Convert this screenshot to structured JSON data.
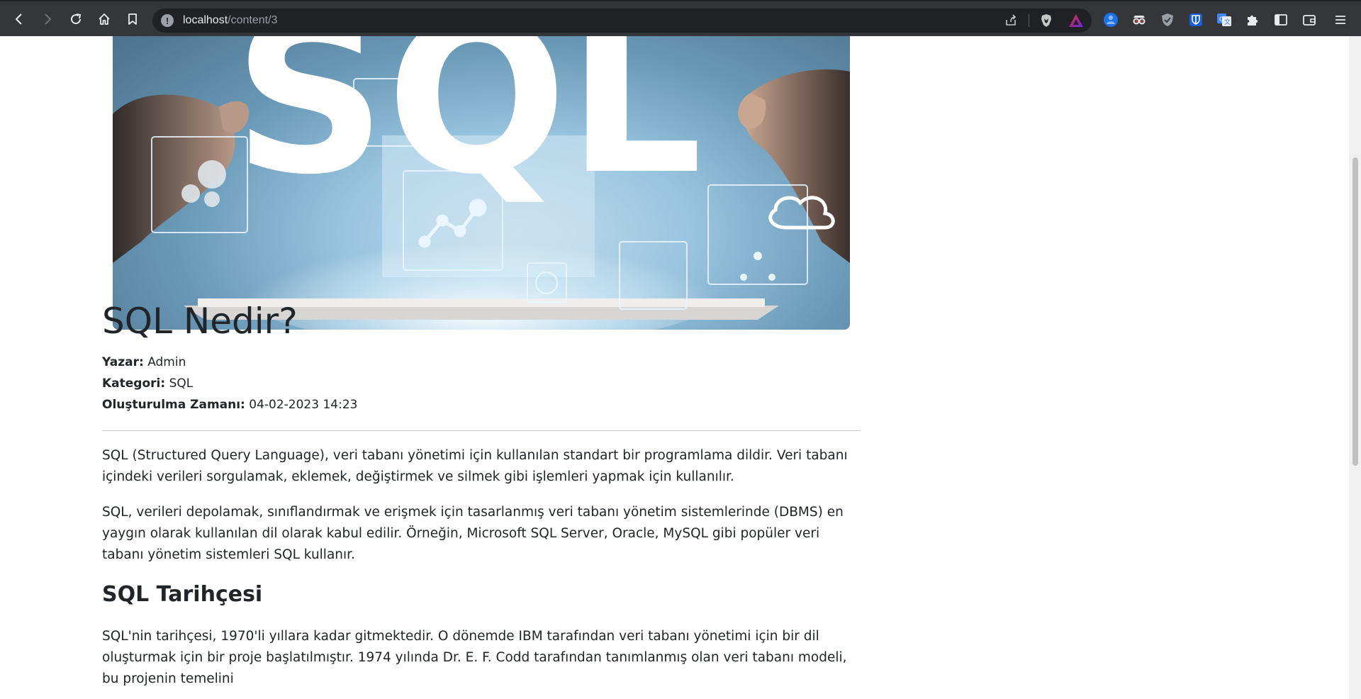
{
  "browser": {
    "url_host": "localhost",
    "url_path": "/content/3",
    "icons": {
      "back": "back-arrow-icon",
      "forward": "forward-arrow-icon",
      "reload": "reload-icon",
      "home": "home-icon",
      "bookmark": "bookmark-icon",
      "info": "info-icon",
      "share": "share-icon",
      "brave_shields": "brave-shields-icon",
      "brave_rewards": "brave-rewards-icon",
      "extensions": [
        "profile-extension-icon",
        "spy-glasses-extension-icon",
        "shield-extension-icon",
        "bitwarden-extension-icon",
        "translate-extension-icon",
        "puzzle-extensions-icon"
      ],
      "sidebar": "sidebar-icon",
      "wallet": "wallet-icon",
      "menu": "menu-icon"
    },
    "colors": {
      "toolbar_bg": "#35363a",
      "omnibox_bg": "#202124"
    }
  },
  "article": {
    "hero_text": "SQL",
    "title": "SQL Nedir?",
    "author_label": "Yazar:",
    "author": "Admin",
    "category_label": "Kategori:",
    "category": "SQL",
    "created_label": "Oluşturulma Zamanı:",
    "created": "04-02-2023 14:23",
    "paragraphs": [
      "SQL (Structured Query Language), veri tabanı yönetimi için kullanılan standart bir programlama dildir. Veri tabanı içindeki verileri sorgulamak, eklemek, değiştirmek ve silmek gibi işlemleri yapmak için kullanılır.",
      "SQL, verileri depolamak, sınıflandırmak ve erişmek için tasarlanmış veri tabanı yönetim sistemlerinde (DBMS) en yaygın olarak kullanılan dil olarak kabul edilir. Örneğin, Microsoft SQL Server, Oracle, MySQL gibi popüler veri tabanı yönetim sistemleri SQL kullanır."
    ],
    "section_heading": "SQL Tarihçesi",
    "section_paragraph": "SQL'nin tarihçesi, 1970'li yıllara kadar gitmektedir. O dönemde IBM tarafından veri tabanı yönetimi için bir dil oluşturmak için bir proje başlatılmıştır. 1974 yılında Dr. E. F. Codd tarafından tanımlanmış olan veri tabanı modeli, bu projenin temelini"
  }
}
